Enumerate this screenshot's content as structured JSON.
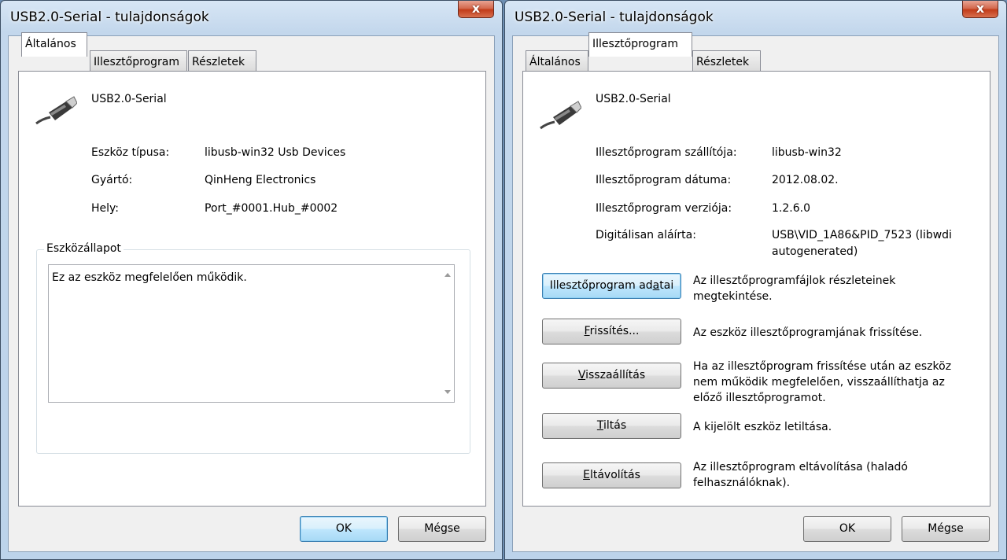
{
  "left_window": {
    "title": "USB2.0-Serial - tulajdonságok",
    "close_label": "x",
    "tabs": [
      "Általános",
      "Illesztőprogram",
      "Részletek"
    ],
    "device_name": "USB2.0-Serial",
    "props": [
      {
        "label": "Eszköz típusa:",
        "value": "libusb-win32 Usb Devices"
      },
      {
        "label": "Gyártó:",
        "value": "QinHeng Electronics"
      },
      {
        "label": "Hely:",
        "value": "Port_#0001.Hub_#0002"
      }
    ],
    "status_group_label": "Eszközállapot",
    "status_text": "Ez az eszköz megfelelően működik.",
    "ok_label": "OK",
    "cancel_label": "Mégse"
  },
  "right_window": {
    "title": "USB2.0-Serial - tulajdonságok",
    "close_label": "x",
    "tabs": [
      "Általános",
      "Illesztőprogram",
      "Részletek"
    ],
    "device_name": "USB2.0-Serial",
    "props": [
      {
        "label": "Illesztőprogram szállítója:",
        "value": "libusb-win32"
      },
      {
        "label": "Illesztőprogram dátuma:",
        "value": "2012.08.02."
      },
      {
        "label": "Illesztőprogram verziója:",
        "value": "1.2.6.0"
      },
      {
        "label": "Digitálisan aláírta:",
        "value": "USB\\VID_1A86&PID_7523 (libwdi",
        "value2": "autogenerated)"
      }
    ],
    "actions": [
      {
        "pre": "Illesztőprogram ad",
        "ul": "a",
        "post": "tai",
        "desc": [
          "Az illesztőprogramfájlok részleteinek",
          "megtekintése."
        ]
      },
      {
        "pre": "",
        "ul": "F",
        "post": "rissítés...",
        "desc": [
          "Az eszköz illesztőprogramjának frissítése."
        ]
      },
      {
        "pre": "",
        "ul": "V",
        "post": "isszaállítás",
        "desc": [
          "Ha az illesztőprogram frissítése után az eszköz",
          "nem működik megfelelően, visszaállíthatja az",
          "előző illesztőprogramot."
        ]
      },
      {
        "pre": "",
        "ul": "T",
        "post": "iltás",
        "desc": [
          "A kijelölt eszköz letiltása."
        ]
      },
      {
        "pre": "",
        "ul": "E",
        "post": "ltávolítás",
        "desc": [
          "Az illesztőprogram eltávolítása (haladó",
          "felhasználóknak)."
        ]
      }
    ],
    "ok_label": "OK",
    "cancel_label": "Mégse"
  }
}
